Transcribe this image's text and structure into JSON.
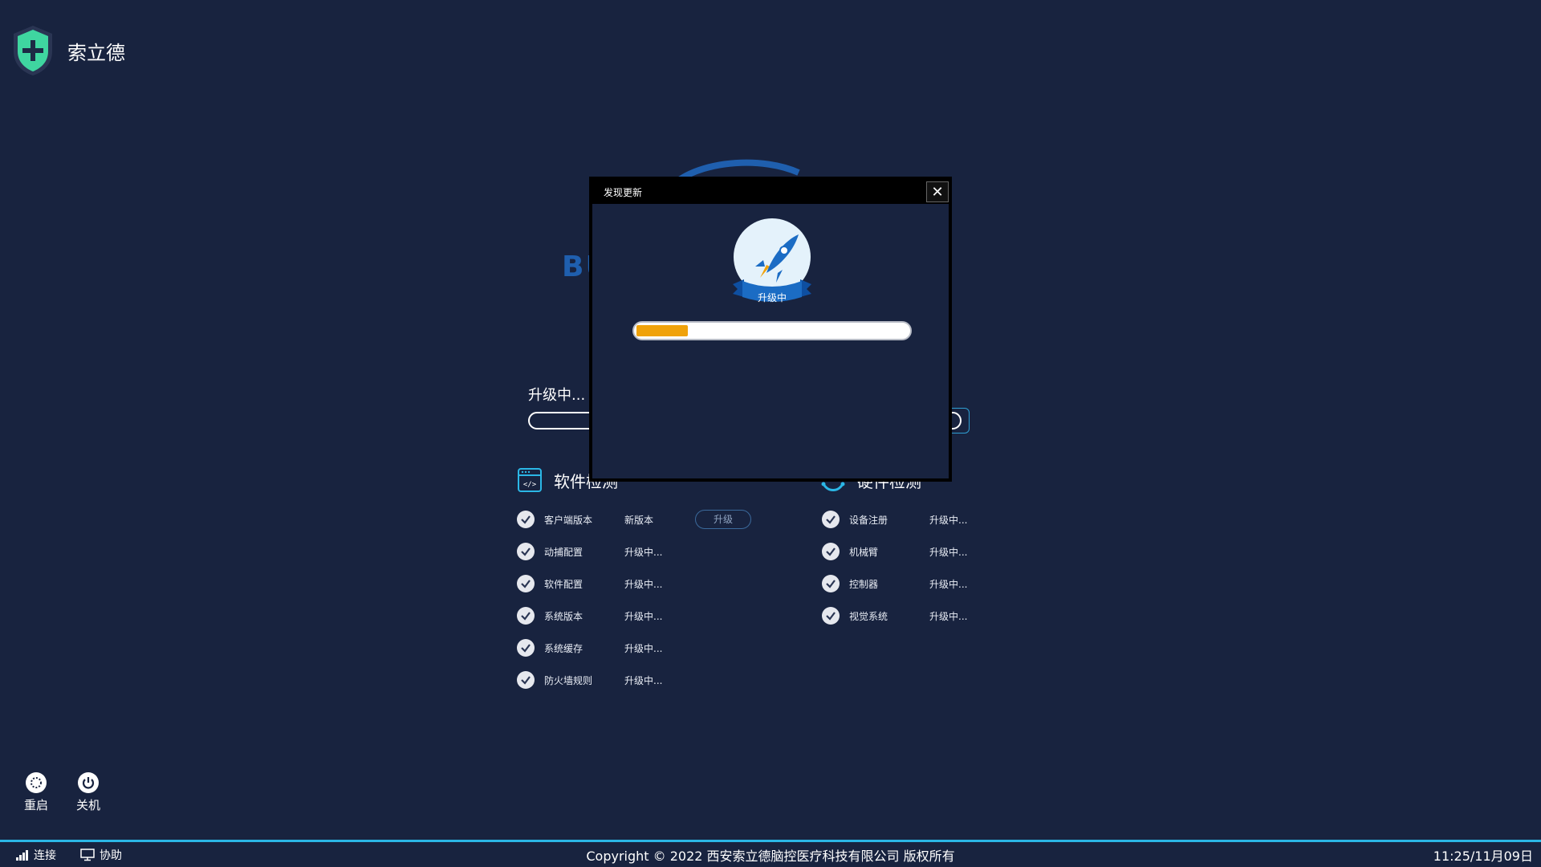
{
  "brand": {
    "name": "索立德"
  },
  "background_panel": {
    "logo_text": "BU",
    "upgrade_label": "升级中...",
    "side_button_label": "·",
    "software_section": {
      "title": "软件检测",
      "items": [
        {
          "name": "客户端版本",
          "status": "新版本",
          "action": "升级"
        },
        {
          "name": "动捕配置",
          "status": "升级中..."
        },
        {
          "name": "软件配置",
          "status": "升级中..."
        },
        {
          "name": "系统版本",
          "status": "升级中..."
        },
        {
          "name": "系统缓存",
          "status": "升级中..."
        },
        {
          "name": "防火墙规则",
          "status": "升级中..."
        }
      ]
    },
    "hardware_section": {
      "title": "硬件检测",
      "items": [
        {
          "name": "设备注册",
          "status": "升级中..."
        },
        {
          "name": "机械臂",
          "status": "升级中..."
        },
        {
          "name": "控制器",
          "status": "升级中..."
        },
        {
          "name": "视觉系统",
          "status": "升级中..."
        }
      ]
    }
  },
  "modal": {
    "title": "发现更新",
    "close_symbol": "✕",
    "badge_label": "升级中",
    "progress": 0.19
  },
  "controls": {
    "restart_label": "重启",
    "shutdown_label": "关机"
  },
  "statusbar": {
    "connect_label": "连接",
    "assist_label": "协助",
    "copyright": "Copyright © 2022 西安索立德脑控医疗科技有限公司 版权所有",
    "clock": "11:25/11月09日"
  },
  "colors": {
    "background": "#18233f",
    "accent": "#2bb7e6",
    "progress_fill": "#f0a20a",
    "brand_green": "#3fd6a0"
  }
}
